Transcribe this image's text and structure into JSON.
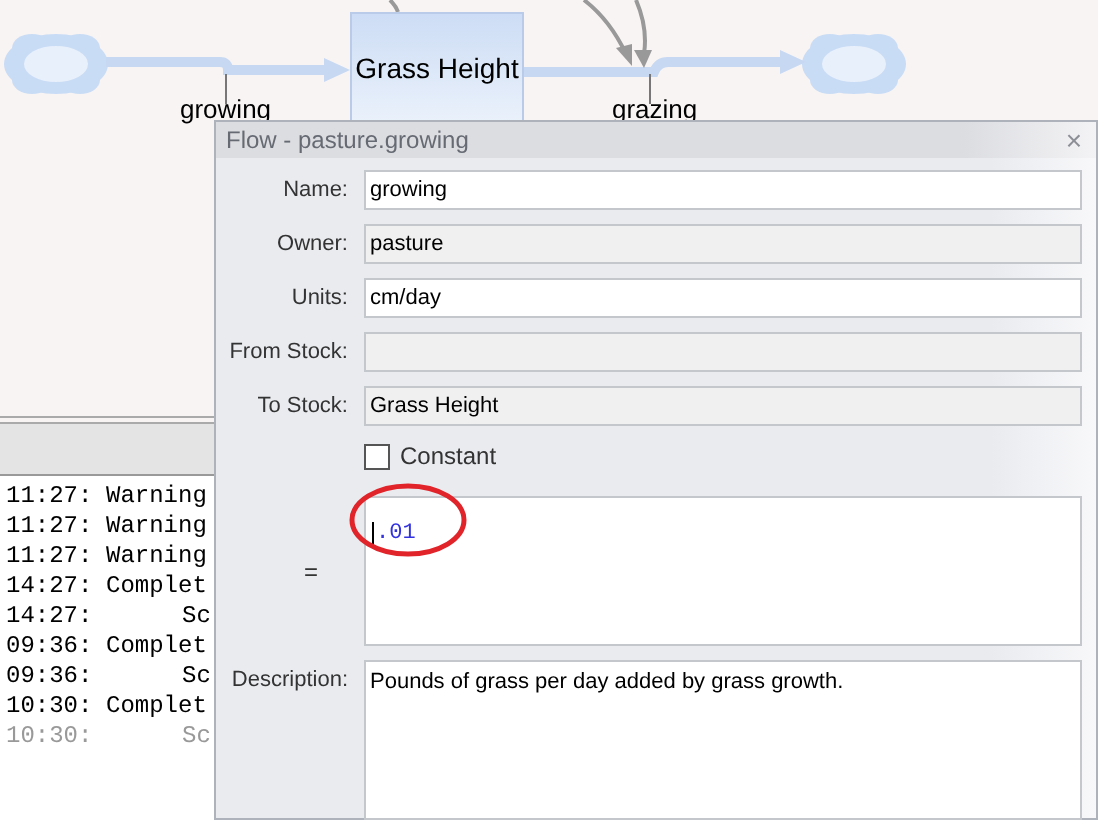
{
  "diagram": {
    "stock": {
      "label": "Grass Height"
    },
    "flows": [
      {
        "label": "growing"
      },
      {
        "label": "grazing"
      }
    ]
  },
  "log": {
    "rows": [
      {
        "time": "11:27:",
        "message": "Warning",
        "kind": "status",
        "faded": false
      },
      {
        "time": "11:27:",
        "message": "Warning",
        "kind": "status",
        "faded": false
      },
      {
        "time": "11:27:",
        "message": "Warning",
        "kind": "status",
        "faded": false
      },
      {
        "time": "14:27:",
        "message": "Complet",
        "kind": "status",
        "faded": false
      },
      {
        "time": "14:27:",
        "message": "Sc",
        "kind": "detail",
        "faded": false
      },
      {
        "time": "09:36:",
        "message": "Complet",
        "kind": "status",
        "faded": false
      },
      {
        "time": "09:36:",
        "message": "Sc",
        "kind": "detail",
        "faded": false
      },
      {
        "time": "10:30:",
        "message": "Complet",
        "kind": "status",
        "faded": false
      },
      {
        "time": "10:30:",
        "message": "Sc",
        "kind": "detail",
        "faded": true
      }
    ]
  },
  "dialog": {
    "title": "Flow - pasture.growing",
    "close": "×",
    "fields": [
      {
        "label": "Name:",
        "value": "growing",
        "readonly": false
      },
      {
        "label": "Owner:",
        "value": "pasture",
        "readonly": true
      },
      {
        "label": "Units:",
        "value": "cm/day",
        "readonly": false
      },
      {
        "label": "From Stock:",
        "readonly": true
      },
      {
        "label": "To Stock:",
        "value": "Grass Height",
        "readonly": true
      }
    ],
    "constant": {
      "label": "Constant",
      "checked": false
    },
    "equation": {
      "label": "=",
      "value": ".01",
      "highlighted": true
    },
    "description": {
      "label": "Description:",
      "value": "Pounds of grass per day added by grass growth."
    }
  }
}
